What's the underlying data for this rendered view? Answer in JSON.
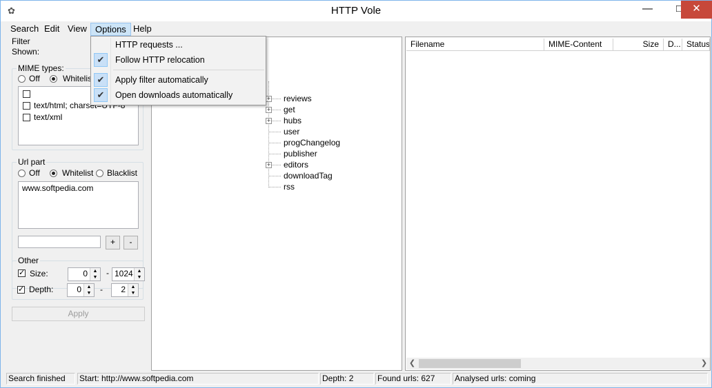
{
  "window": {
    "title": "HTTP Vole",
    "controls": {
      "minimize": "—",
      "maximize": "□",
      "close": "✕"
    }
  },
  "menubar": [
    "Search",
    "Edit",
    "View",
    "Options",
    "Help"
  ],
  "options_menu": [
    {
      "label": "HTTP requests ...",
      "checked": false
    },
    {
      "label": "Follow HTTP relocation",
      "checked": true
    },
    {
      "label": "Apply filter automatically",
      "checked": true
    },
    {
      "label": "Open downloads automatically",
      "checked": true
    }
  ],
  "filter": {
    "title": "Filter",
    "shown_label": "Shown:",
    "mime": {
      "title": "MIME types:",
      "off": "Off",
      "whitelist": "Whitelist",
      "items": [
        "",
        "text/html; charset=UTF-8",
        "text/xml"
      ]
    },
    "url": {
      "title": "Url part",
      "off": "Off",
      "whitelist": "Whitelist",
      "blacklist": "Blacklist",
      "items": [
        "www.softpedia.com"
      ],
      "add_value": "",
      "add_button": "+",
      "remove_button": "-"
    },
    "other": {
      "title": "Other",
      "size_label": "Size:",
      "size_from": "0",
      "size_to": "1024",
      "depth_label": "Depth:",
      "depth_from": "0",
      "depth_to": "2",
      "dash": "-"
    },
    "apply_button": "Apply"
  },
  "tree": {
    "items": [
      {
        "label": "reviews",
        "expandable": true
      },
      {
        "label": "get",
        "expandable": true
      },
      {
        "label": "hubs",
        "expandable": true
      },
      {
        "label": "user",
        "expandable": false
      },
      {
        "label": "progChangelog",
        "expandable": false
      },
      {
        "label": "publisher",
        "expandable": false
      },
      {
        "label": "editors",
        "expandable": true
      },
      {
        "label": "downloadTag",
        "expandable": false
      },
      {
        "label": "rss",
        "expandable": false
      }
    ]
  },
  "list": {
    "columns": [
      "Filename",
      "MIME-Content",
      "Size",
      "D...",
      "Status"
    ]
  },
  "statusbar": {
    "state": "Search finished",
    "start": "Start: http://www.softpedia.com",
    "depth": "Depth: 2",
    "found": "Found urls: 627",
    "analysed": "Analysed urls: coming"
  }
}
